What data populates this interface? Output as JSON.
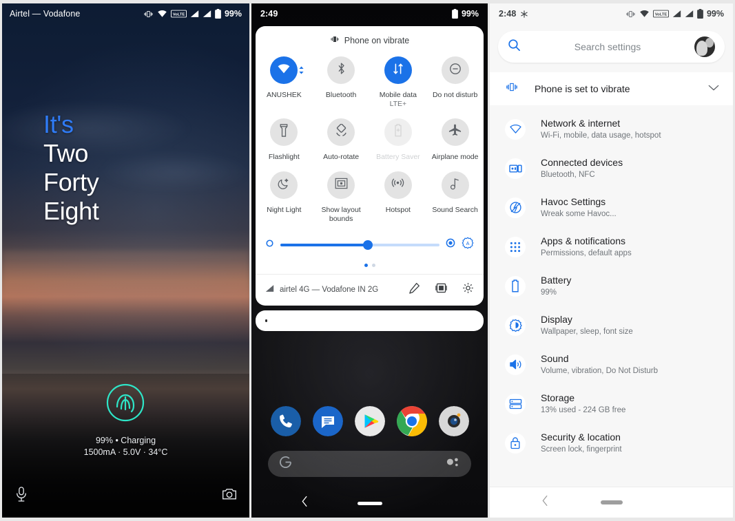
{
  "lock_screen": {
    "status_bar": {
      "carrier": "Airtel — Vodafone",
      "battery_percent": "99%",
      "icons": [
        "vibrate-icon",
        "wifi-icon",
        "volte-icon",
        "signal-sim1-icon",
        "signal-sim2-icon",
        "battery-charging-icon"
      ],
      "volte_label": "VoLTE"
    },
    "clock": {
      "line1": "It's",
      "line2": "Two",
      "line3": "Forty",
      "line4": "Eight",
      "accent_color": "#2f7bf6"
    },
    "fingerprint_icon": "fingerprint-icon",
    "fingerprint_color": "#2ee6c8",
    "battery_line1": "99% • Charging",
    "battery_line2": "1500mA · 5.0V · 34°C",
    "left_shortcut": "microphone-assistant-icon",
    "right_shortcut": "camera-icon"
  },
  "quick_settings": {
    "status_bar": {
      "time": "2:49",
      "battery_percent": "99%"
    },
    "header_status": "Phone on vibrate",
    "header_icon": "vibrate-icon",
    "tiles": [
      {
        "label": "ANUSHEK",
        "sub": "",
        "icon": "wifi-icon",
        "active": true,
        "disabled": false,
        "has_chevron": true
      },
      {
        "label": "Bluetooth",
        "sub": "",
        "icon": "bluetooth-icon",
        "active": false,
        "disabled": false,
        "has_chevron": false
      },
      {
        "label": "Mobile data",
        "sub": "LTE+",
        "icon": "mobile-data-icon",
        "active": true,
        "disabled": false,
        "has_chevron": false
      },
      {
        "label": "Do not disturb",
        "sub": "",
        "icon": "do-not-disturb-icon",
        "active": false,
        "disabled": false,
        "has_chevron": false
      },
      {
        "label": "Flashlight",
        "sub": "",
        "icon": "flashlight-icon",
        "active": false,
        "disabled": false,
        "has_chevron": false
      },
      {
        "label": "Auto-rotate",
        "sub": "",
        "icon": "auto-rotate-icon",
        "active": false,
        "disabled": false,
        "has_chevron": false
      },
      {
        "label": "Battery Saver",
        "sub": "",
        "icon": "battery-saver-icon",
        "active": false,
        "disabled": true,
        "has_chevron": false
      },
      {
        "label": "Airplane mode",
        "sub": "",
        "icon": "airplane-icon",
        "active": false,
        "disabled": false,
        "has_chevron": false
      },
      {
        "label": "Night Light",
        "sub": "",
        "icon": "night-light-icon",
        "active": false,
        "disabled": false,
        "has_chevron": false
      },
      {
        "label": "Show layout bounds",
        "sub": "",
        "icon": "layout-bounds-icon",
        "active": false,
        "disabled": false,
        "has_chevron": false
      },
      {
        "label": "Hotspot",
        "sub": "",
        "icon": "hotspot-icon",
        "active": false,
        "disabled": false,
        "has_chevron": false
      },
      {
        "label": "Sound Search",
        "sub": "",
        "icon": "sound-search-icon",
        "active": false,
        "disabled": false,
        "has_chevron": false
      }
    ],
    "brightness": {
      "value_percent": 55,
      "left_icon": "brightness-low-icon",
      "right_icon": "brightness-high-icon",
      "auto_icon": "auto-brightness-icon",
      "accent_color": "#1b72e8"
    },
    "page_dots": {
      "count": 2,
      "active_index": 0
    },
    "footer": {
      "carrier": "airtel 4G — Vodafone IN 2G",
      "signal_icon": "signal-icon",
      "edit_icon": "edit-pencil-icon",
      "users_icon": "multi-user-icon",
      "settings_icon": "gear-icon"
    },
    "home": {
      "dock_apps": [
        "phone-icon",
        "messages-icon",
        "play-store-icon",
        "chrome-icon",
        "camera-icon"
      ],
      "search_left_icon": "google-g-icon",
      "search_right_icon": "google-assistant-icon"
    },
    "navbar": {
      "back_icon": "back-chevron-icon",
      "home_icon": "home-pill-icon"
    }
  },
  "settings": {
    "status_bar": {
      "time": "2:48",
      "leaf_icon": "asterisk-icon",
      "battery_percent": "99%",
      "icons": [
        "vibrate-icon",
        "wifi-icon",
        "volte-icon",
        "signal-sim1-icon",
        "signal-sim2-icon",
        "battery-icon"
      ],
      "volte_label": "VoLTE"
    },
    "search": {
      "placeholder": "Search settings",
      "search_icon": "search-icon",
      "avatar": "user-avatar"
    },
    "vibrate_row": {
      "label": "Phone is set to vibrate",
      "icon": "vibrate-icon",
      "chevron": "chevron-down-icon"
    },
    "items": [
      {
        "title": "Network & internet",
        "sub": "Wi-Fi, mobile, data usage, hotspot",
        "icon": "wifi-icon"
      },
      {
        "title": "Connected devices",
        "sub": "Bluetooth, NFC",
        "icon": "connected-devices-icon"
      },
      {
        "title": "Havoc Settings",
        "sub": "Wreak some Havoc...",
        "icon": "havoc-icon"
      },
      {
        "title": "Apps & notifications",
        "sub": "Permissions, default apps",
        "icon": "apps-grid-icon"
      },
      {
        "title": "Battery",
        "sub": "99%",
        "icon": "battery-icon"
      },
      {
        "title": "Display",
        "sub": "Wallpaper, sleep, font size",
        "icon": "display-brightness-icon"
      },
      {
        "title": "Sound",
        "sub": "Volume, vibration, Do Not Disturb",
        "icon": "sound-speaker-icon"
      },
      {
        "title": "Storage",
        "sub": "13% used - 224 GB free",
        "icon": "storage-icon"
      },
      {
        "title": "Security & location",
        "sub": "Screen lock, fingerprint",
        "icon": "lock-icon"
      }
    ],
    "navbar": {
      "back_icon": "back-chevron-icon",
      "home_icon": "home-pill-icon"
    },
    "accent_color": "#1b72e8"
  }
}
